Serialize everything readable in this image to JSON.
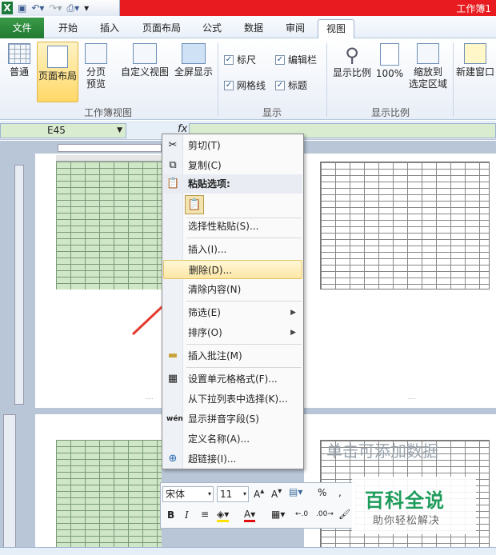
{
  "window": {
    "title": "工作簿1"
  },
  "quick_access": {
    "excel_icon": "excel-icon",
    "save_icon": "save-icon",
    "undo_icon": "undo-icon",
    "redo_icon": "redo-icon",
    "preview_icon": "print-preview-icon"
  },
  "tabs": {
    "file": "文件",
    "items": [
      "开始",
      "插入",
      "页面布局",
      "公式",
      "数据",
      "审阅",
      "视图"
    ],
    "active": "视图"
  },
  "ribbon": {
    "workbook_views": {
      "normal": "普通",
      "page_layout": "页面布局",
      "page_break_1": "分页",
      "page_break_2": "预览",
      "custom_view": "自定义视图",
      "full_screen": "全屏显示",
      "group_label": "工作簿视图"
    },
    "show": {
      "ruler": "标尺",
      "formula_bar": "编辑栏",
      "gridlines": "网格线",
      "headings": "标题",
      "group_label": "显示"
    },
    "zoom": {
      "zoom": "显示比例",
      "hundred": "100%",
      "zoom_sel_1": "缩放到",
      "zoom_sel_2": "选定区域",
      "group_label": "显示比例"
    },
    "window": {
      "new_window": "新建窗口"
    }
  },
  "formula_bar": {
    "name_box": "E45",
    "fx": "fx"
  },
  "context_menu": {
    "items": [
      "剪切(T)",
      "复制(C)",
      "粘贴选项:",
      "选择性粘贴(S)...",
      "插入(I)...",
      "删除(D)...",
      "清除内容(N)",
      "筛选(E)",
      "排序(O)",
      "插入批注(M)",
      "设置单元格格式(F)...",
      "从下拉列表中选择(K)...",
      "显示拼音字段(S)",
      "定义名称(A)...",
      "超链接(I)..."
    ],
    "highlighted": "删除(D)..."
  },
  "mini_toolbar": {
    "font": "宋体",
    "size": "11",
    "percent": "%",
    "comma": ",",
    "bold": "B",
    "italic": "I"
  },
  "page_placeholder": "单击可添加数据",
  "watermark": {
    "title": "百科全说",
    "subtitle": "助你轻松解决"
  },
  "colors": {
    "title_bar": "#e81c20",
    "file_tab": "#217a33",
    "highlight": "#fde7a6",
    "cell_fill": "#cfe6c7"
  }
}
